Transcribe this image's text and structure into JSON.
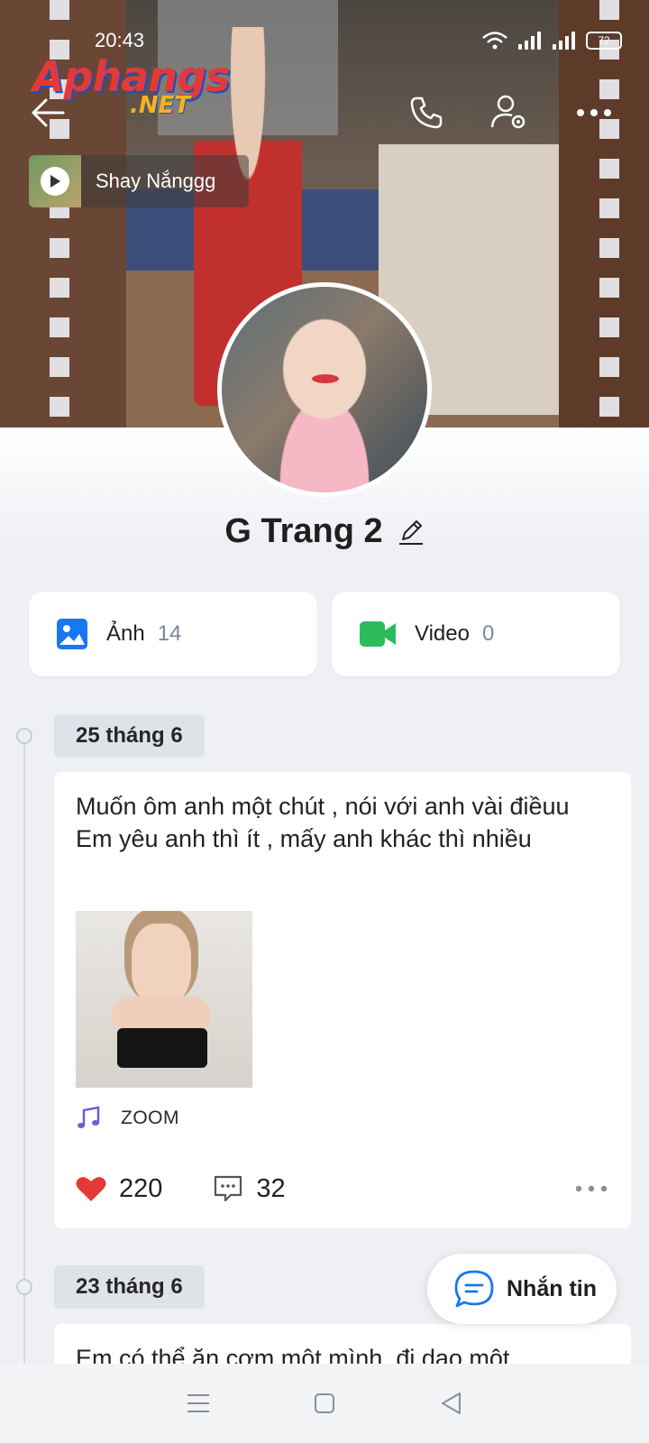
{
  "status_bar": {
    "time": "20:43",
    "battery": "72"
  },
  "watermark": {
    "brand": "Aphangs",
    "suffix": ".NET"
  },
  "music_badge": {
    "title": "Shay Nắnggg"
  },
  "profile": {
    "name": "G Trang 2"
  },
  "media": [
    {
      "label": "Ảnh",
      "count": "14",
      "icon": "image-icon",
      "color": "#1877f2"
    },
    {
      "label": "Video",
      "count": "0",
      "icon": "video-camera-icon",
      "color": "#2dbb5c"
    }
  ],
  "posts": [
    {
      "date": "25 tháng 6",
      "text": "Muốn ôm anh một chút , nói với anh vài điềuu\nEm yêu anh thì ít , mấy anh khác thì nhiều",
      "song": "ZOOM",
      "likes": "220",
      "comments": "32"
    },
    {
      "date": "23 tháng 6",
      "text": "Em có thể ăn cơm một mình, đi dạo một"
    }
  ],
  "message_button": {
    "label": "Nhắn tin"
  },
  "colors": {
    "accent": "#1877f2",
    "like": "#e53935",
    "music": "#6a5fd6"
  }
}
